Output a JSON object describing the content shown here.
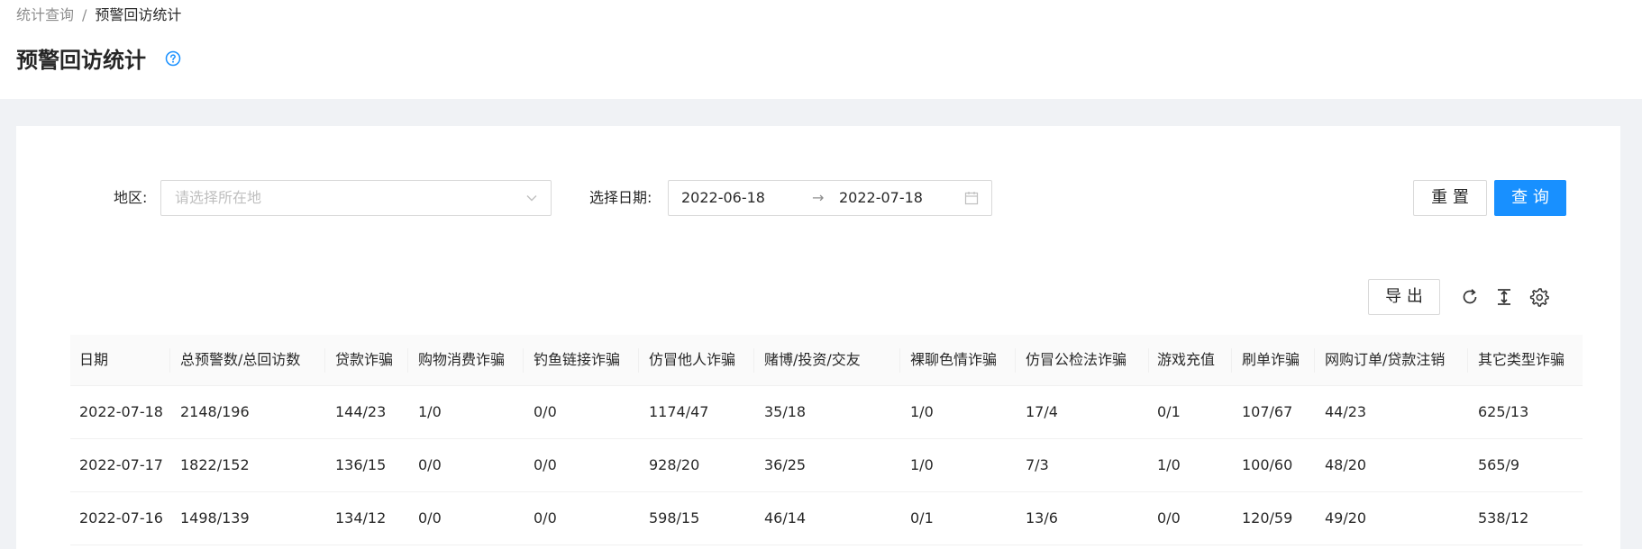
{
  "breadcrumb": {
    "parent": "统计查询",
    "separator": "/",
    "current": "预警回访统计"
  },
  "page": {
    "title": "预警回访统计",
    "help_icon": "question-circle-icon"
  },
  "filters": {
    "region_label": "地区:",
    "region_placeholder": "请选择所在地",
    "date_label": "选择日期:",
    "date_start": "2022-06-18",
    "date_arrow": "→",
    "date_end": "2022-07-18"
  },
  "buttons": {
    "reset": "重 置",
    "query": "查 询",
    "export": "导 出"
  },
  "toolbar_icons": [
    "reload-icon",
    "column-height-icon",
    "setting-icon"
  ],
  "colors": {
    "primary": "#1890ff",
    "border": "#d9d9d9",
    "background": "#f0f2f5"
  },
  "table": {
    "columns": [
      "日期",
      "总预警数/总回访数",
      "贷款诈骗",
      "购物消费诈骗",
      "钓鱼链接诈骗",
      "仿冒他人诈骗",
      "赌博/投资/交友",
      "裸聊色情诈骗",
      "仿冒公检法诈骗",
      "游戏充值",
      "刷单诈骗",
      "网购订单/贷款注销",
      "其它类型诈骗"
    ],
    "rows": [
      [
        "2022-07-18",
        "2148/196",
        "144/23",
        "1/0",
        "0/0",
        "1174/47",
        "35/18",
        "1/0",
        "17/4",
        "0/1",
        "107/67",
        "44/23",
        "625/13"
      ],
      [
        "2022-07-17",
        "1822/152",
        "136/15",
        "0/0",
        "0/0",
        "928/20",
        "36/25",
        "1/0",
        "7/3",
        "1/0",
        "100/60",
        "48/20",
        "565/9"
      ],
      [
        "2022-07-16",
        "1498/139",
        "134/12",
        "0/0",
        "0/0",
        "598/15",
        "46/14",
        "0/1",
        "13/6",
        "0/0",
        "120/59",
        "49/20",
        "538/12"
      ]
    ]
  }
}
